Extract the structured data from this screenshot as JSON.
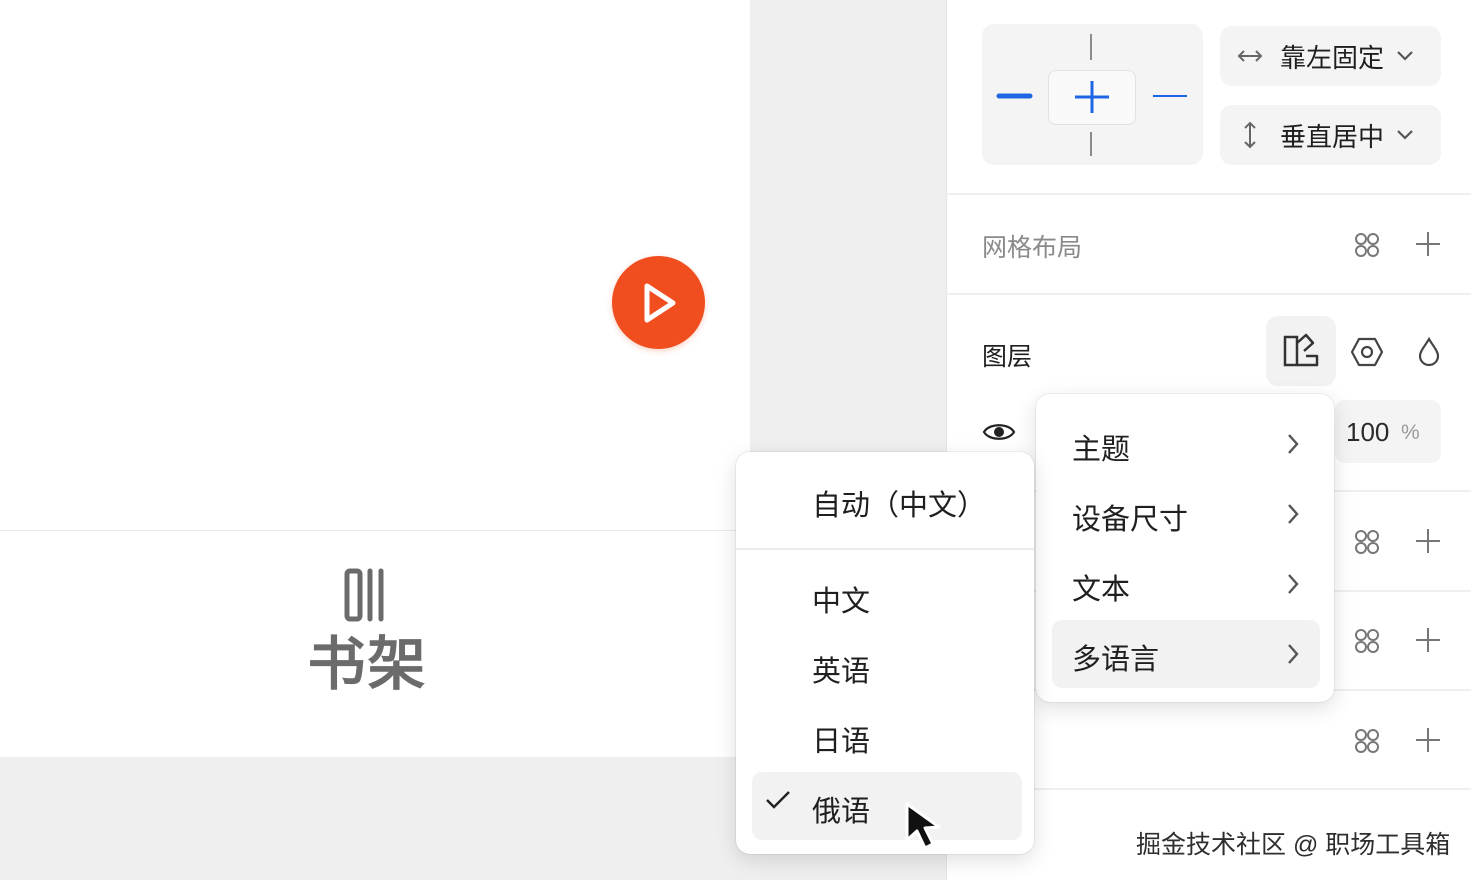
{
  "canvas": {
    "bookshelf_label": "书架",
    "play_button_color": "#f04e1e"
  },
  "constraints": {
    "horizontal": {
      "icon": "horizontal-arrows-icon",
      "label": "靠左固定"
    },
    "vertical": {
      "icon": "vertical-arrows-icon",
      "label": "垂直居中"
    }
  },
  "grid_layout": {
    "title": "网格布局"
  },
  "layers": {
    "title": "图层",
    "opacity_value": "100",
    "opacity_unit": "%"
  },
  "context_menu": {
    "items": [
      {
        "label": "主题"
      },
      {
        "label": "设备尺寸"
      },
      {
        "label": "文本"
      },
      {
        "label": "多语言",
        "active": true
      }
    ]
  },
  "language_menu": {
    "auto": "自动（中文）",
    "options": [
      {
        "label": "中文"
      },
      {
        "label": "英语"
      },
      {
        "label": "日语"
      },
      {
        "label": "俄语",
        "selected": true
      }
    ]
  },
  "watermark": "掘金技术社区 @ 职场工具箱",
  "colors": {
    "accent": "#1f66e5",
    "brand_orange": "#f04e1e"
  }
}
